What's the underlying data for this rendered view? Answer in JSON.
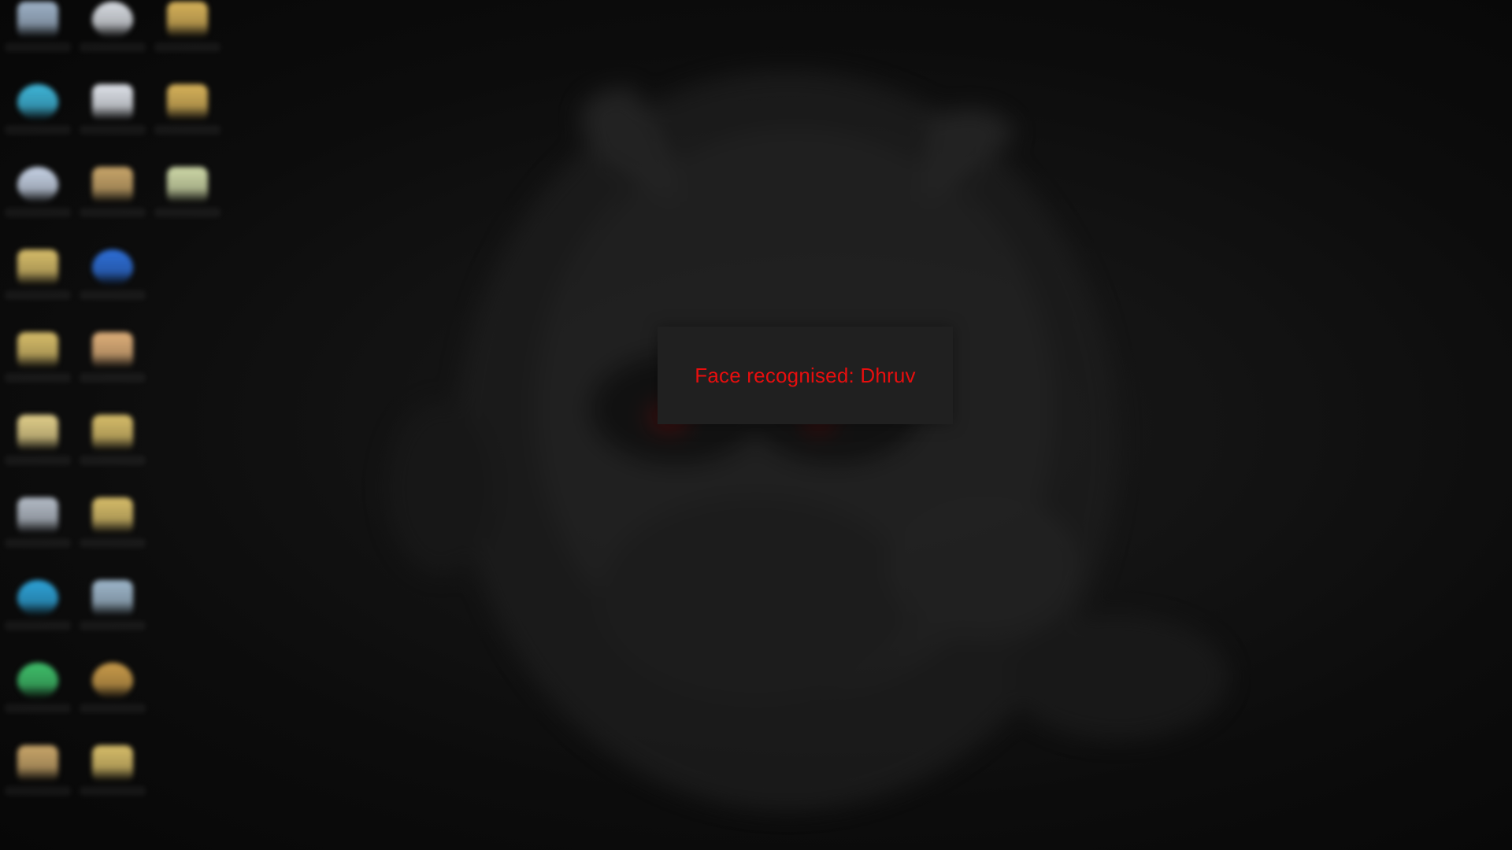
{
  "notification": {
    "message": "Face recognised: Dhruv",
    "text_color": "#e80e0e",
    "background": "#202020"
  },
  "desktop": {
    "icons": [
      {
        "name": "shortcut-icon",
        "color": "#9fb3c9"
      },
      {
        "name": "app-icon",
        "color": "#d9dde3"
      },
      {
        "name": "folder-icon",
        "color": "#d8b35a"
      },
      {
        "name": "browser-icon",
        "color": "#3fb6d9"
      },
      {
        "name": "document-icon",
        "color": "#dfe3ea"
      },
      {
        "name": "folder-icon",
        "color": "#d8b35a"
      },
      {
        "name": "app-icon",
        "color": "#c7d3e6"
      },
      {
        "name": "folder-icon",
        "color": "#c9a66a"
      },
      {
        "name": "image-icon",
        "color": "#cfd9a8"
      },
      {
        "name": "folder-icon",
        "color": "#d8be6a"
      },
      {
        "name": "app-icon",
        "color": "#2e6fd8"
      },
      {
        "name": "folder-icon",
        "color": "#d8be6a"
      },
      {
        "name": "folder-icon",
        "color": "#e0b07a"
      },
      {
        "name": "folder-icon",
        "color": "#e2cf8a"
      },
      {
        "name": "folder-icon",
        "color": "#d8be6a"
      },
      {
        "name": "shortcut-icon",
        "color": "#b4bcc7"
      },
      {
        "name": "folder-icon",
        "color": "#d8be6a"
      },
      {
        "name": "browser-icon",
        "color": "#2ea3d8"
      },
      {
        "name": "shortcut-icon",
        "color": "#9fb8cc"
      },
      {
        "name": "app-icon",
        "color": "#3fbf6a"
      },
      {
        "name": "app-icon",
        "color": "#c99b4a"
      },
      {
        "name": "folder-icon",
        "color": "#c9a66a"
      },
      {
        "name": "folder-icon",
        "color": "#d8be6a"
      }
    ]
  }
}
